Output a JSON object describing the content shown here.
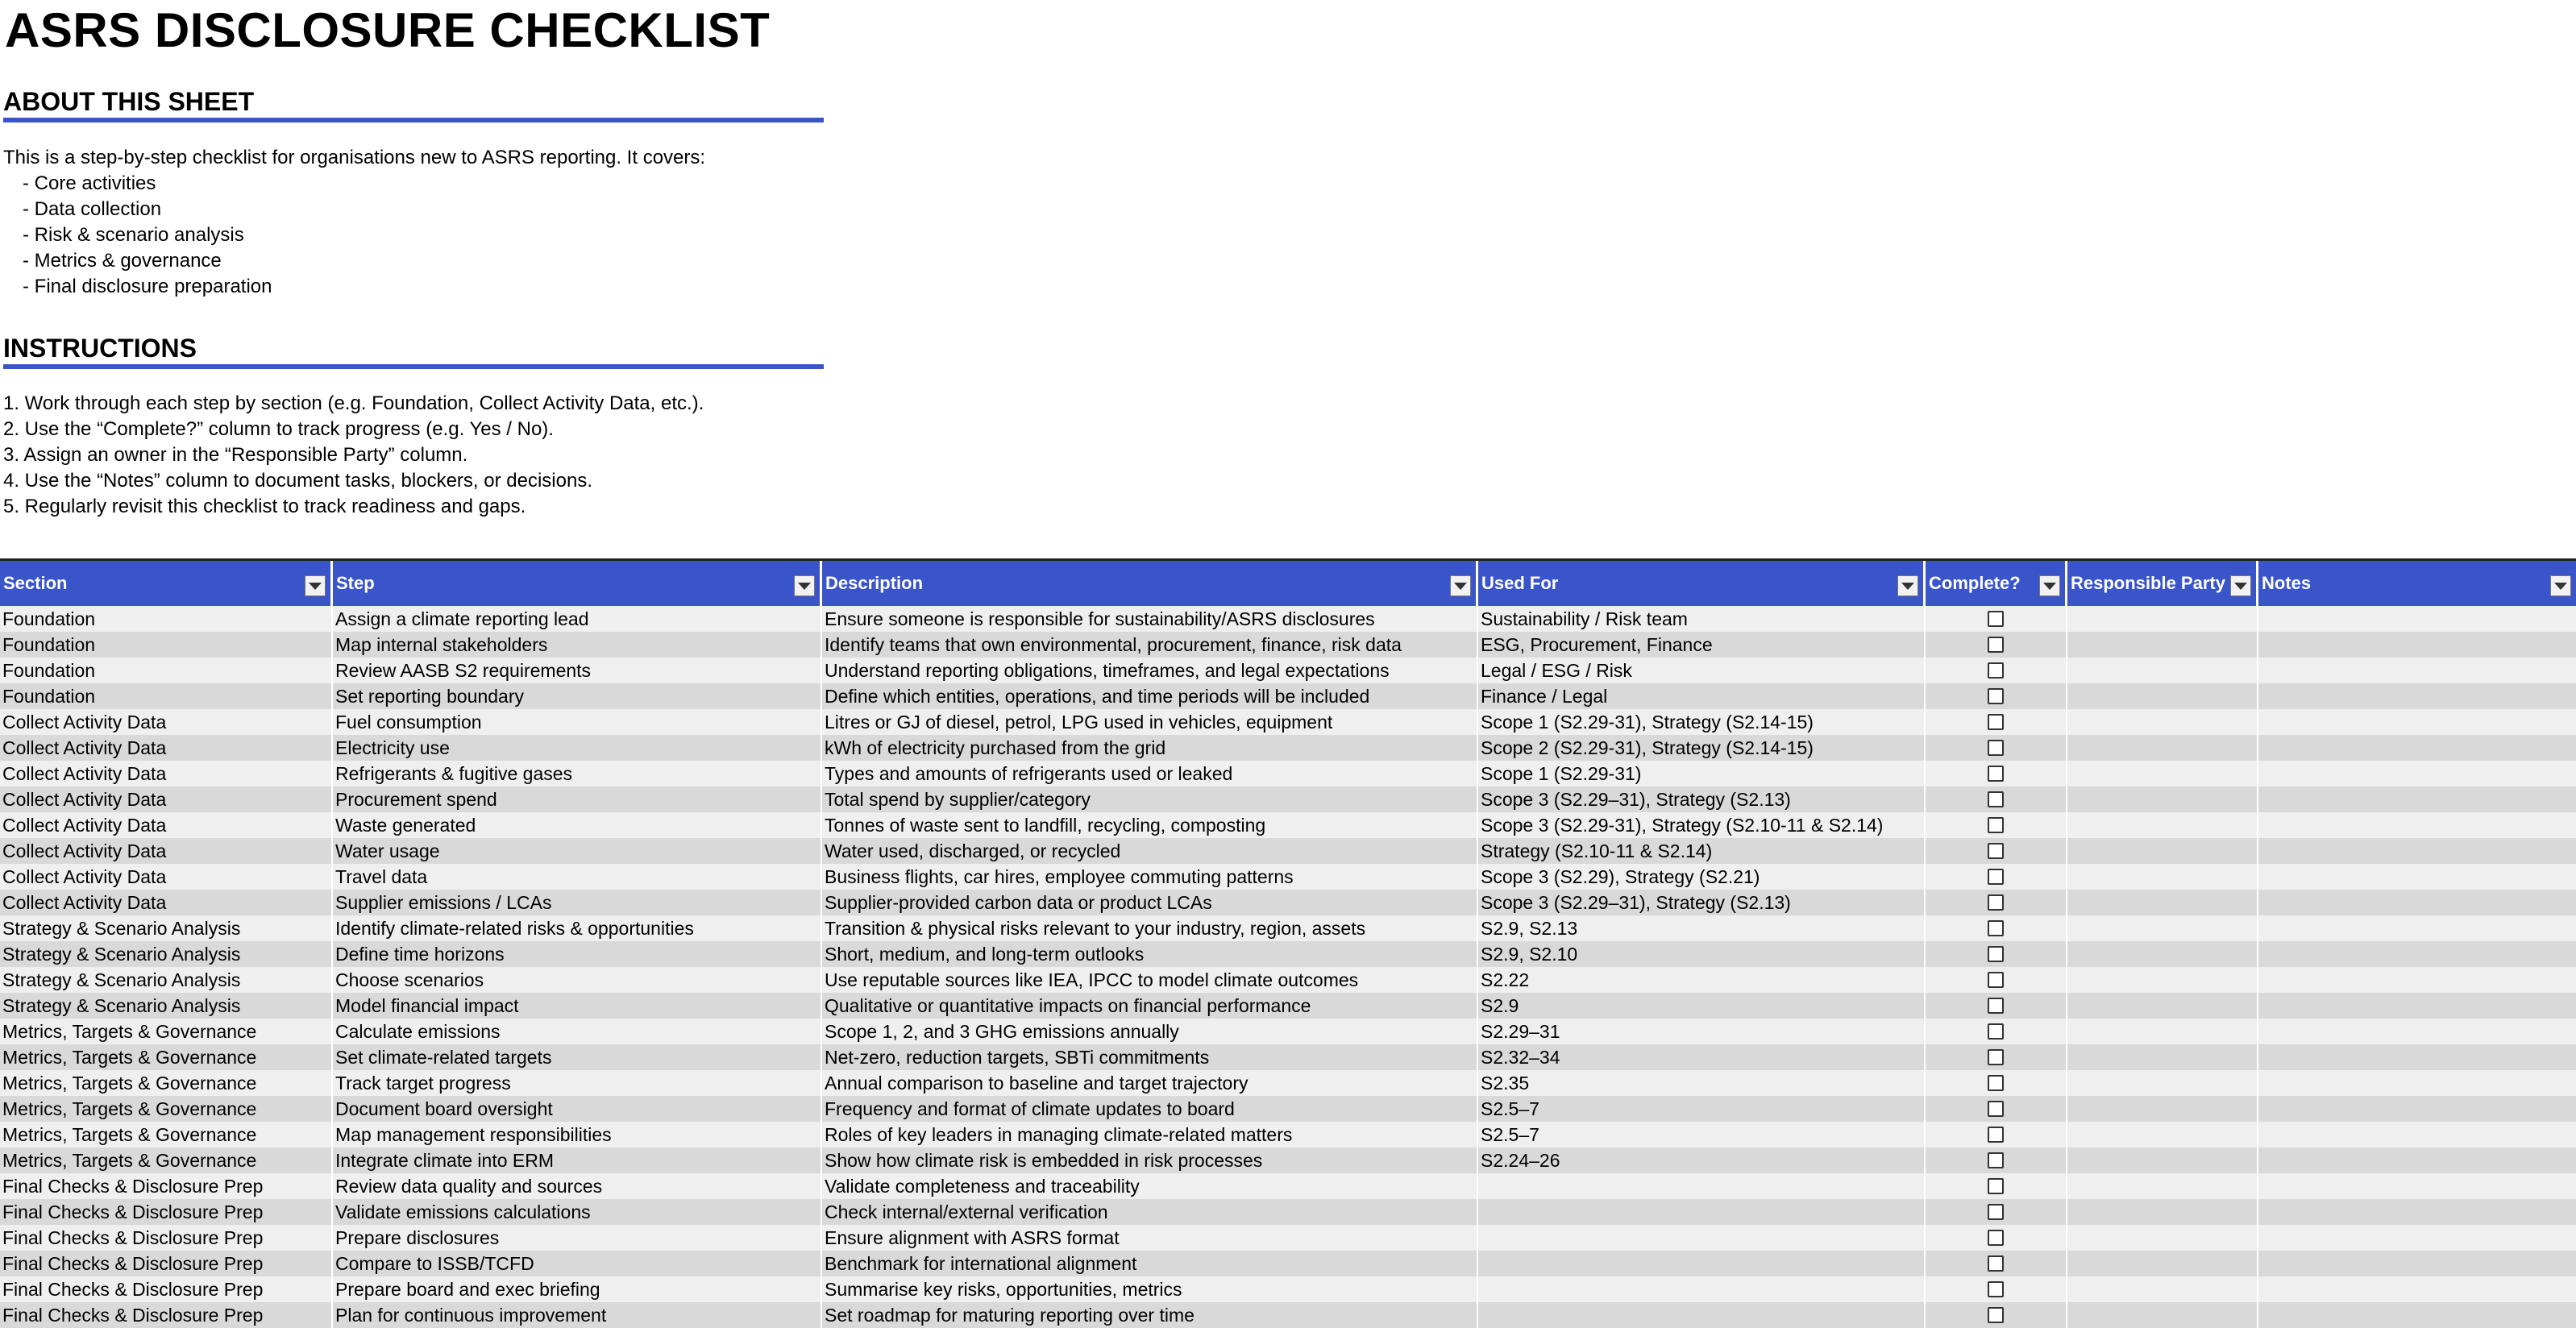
{
  "title": "ASRS DISCLOSURE CHECKLIST",
  "about": {
    "heading": "ABOUT THIS SHEET",
    "intro": "This is a step-by-step checklist for organisations new to ASRS reporting. It covers:",
    "bullets": [
      "- Core activities",
      "- Data collection",
      "- Risk & scenario analysis",
      "- Metrics & governance",
      "- Final disclosure preparation"
    ]
  },
  "instructions": {
    "heading": "INSTRUCTIONS",
    "lines": [
      "1. Work through each step by section (e.g. Foundation, Collect Activity Data, etc.).",
      "2. Use the “Complete?” column to track progress (e.g. Yes / No).",
      "3. Assign an owner in the “Responsible Party” column.",
      "4. Use the “Notes” column to document tasks, blockers, or decisions.",
      "5. Regularly revisit this checklist to track readiness and gaps."
    ]
  },
  "table": {
    "headers": [
      "Section",
      "Step",
      "Description",
      "Used For",
      "Complete?",
      "Responsible Party",
      "Notes"
    ],
    "rows": [
      [
        "Foundation",
        "Assign a climate reporting lead",
        "Ensure someone is responsible for sustainability/ASRS disclosures",
        "Sustainability / Risk team"
      ],
      [
        "Foundation",
        "Map internal stakeholders",
        "Identify teams that own environmental, procurement, finance, risk data",
        "ESG, Procurement, Finance"
      ],
      [
        "Foundation",
        "Review AASB S2 requirements",
        "Understand reporting obligations, timeframes, and legal expectations",
        "Legal / ESG / Risk"
      ],
      [
        "Foundation",
        "Set reporting boundary",
        "Define which entities, operations, and time periods will be included",
        "Finance / Legal"
      ],
      [
        "Collect Activity Data",
        "Fuel consumption",
        "Litres or GJ of diesel, petrol, LPG used in vehicles, equipment",
        "Scope 1 (S2.29-31), Strategy (S2.14-15)"
      ],
      [
        "Collect Activity Data",
        "Electricity use",
        "kWh of electricity purchased from the grid",
        "Scope 2 (S2.29-31), Strategy (S2.14-15)"
      ],
      [
        "Collect Activity Data",
        "Refrigerants & fugitive gases",
        "Types and amounts of refrigerants used or leaked",
        "Scope 1 (S2.29-31)"
      ],
      [
        "Collect Activity Data",
        "Procurement spend",
        "Total spend by supplier/category",
        "Scope 3 (S2.29–31), Strategy (S2.13)"
      ],
      [
        "Collect Activity Data",
        "Waste generated",
        "Tonnes of waste sent to landfill, recycling, composting",
        "Scope 3 (S2.29-31), Strategy (S2.10-11 & S2.14)"
      ],
      [
        "Collect Activity Data",
        "Water usage",
        "Water used, discharged, or recycled",
        "Strategy (S2.10-11 & S2.14)"
      ],
      [
        "Collect Activity Data",
        "Travel data",
        "Business flights, car hires, employee commuting patterns",
        "Scope 3 (S2.29), Strategy (S2.21)"
      ],
      [
        "Collect Activity Data",
        "Supplier emissions / LCAs",
        "Supplier-provided carbon data or product LCAs",
        "Scope 3 (S2.29–31), Strategy (S2.13)"
      ],
      [
        "Strategy & Scenario Analysis",
        "Identify climate-related risks & opportunities",
        "Transition & physical risks relevant to your industry, region, assets",
        "S2.9, S2.13"
      ],
      [
        "Strategy & Scenario Analysis",
        "Define time horizons",
        "Short, medium, and long-term outlooks",
        "S2.9, S2.10"
      ],
      [
        "Strategy & Scenario Analysis",
        "Choose scenarios",
        "Use reputable sources like IEA, IPCC to model climate outcomes",
        "S2.22"
      ],
      [
        "Strategy & Scenario Analysis",
        "Model financial impact",
        "Qualitative or quantitative impacts on financial performance",
        "S2.9"
      ],
      [
        "Metrics, Targets & Governance",
        "Calculate emissions",
        "Scope 1, 2, and 3 GHG emissions annually",
        "S2.29–31"
      ],
      [
        "Metrics, Targets & Governance",
        "Set climate-related targets",
        "Net-zero, reduction targets, SBTi commitments",
        "S2.32–34"
      ],
      [
        "Metrics, Targets & Governance",
        "Track target progress",
        "Annual comparison to baseline and target trajectory",
        "S2.35"
      ],
      [
        "Metrics, Targets & Governance",
        "Document board oversight",
        "Frequency and format of climate updates to board",
        "S2.5–7"
      ],
      [
        "Metrics, Targets & Governance",
        "Map management responsibilities",
        "Roles of key leaders in managing climate-related matters",
        "S2.5–7"
      ],
      [
        "Metrics, Targets & Governance",
        "Integrate climate into ERM",
        "Show how climate risk is embedded in risk processes",
        "S2.24–26"
      ],
      [
        "Final Checks & Disclosure Prep",
        "Review data quality and sources",
        "Validate completeness and traceability",
        ""
      ],
      [
        "Final Checks & Disclosure Prep",
        "Validate emissions calculations",
        "Check internal/external verification",
        ""
      ],
      [
        "Final Checks & Disclosure Prep",
        "Prepare disclosures",
        "Ensure alignment with ASRS format",
        ""
      ],
      [
        "Final Checks & Disclosure Prep",
        "Compare to ISSB/TCFD",
        "Benchmark for international alignment",
        ""
      ],
      [
        "Final Checks & Disclosure Prep",
        "Prepare board and exec briefing",
        "Summarise key risks, opportunities, metrics",
        ""
      ],
      [
        "Final Checks & Disclosure Prep",
        "Plan for continuous improvement",
        "Set roadmap for maturing reporting over time",
        ""
      ]
    ]
  },
  "colors": {
    "header_bg": "#3a54c9",
    "row_light": "#efefef",
    "row_dark": "#d9d9d9"
  },
  "icons": {
    "filter": "filter-dropdown-icon",
    "checkbox": "checkbox"
  }
}
